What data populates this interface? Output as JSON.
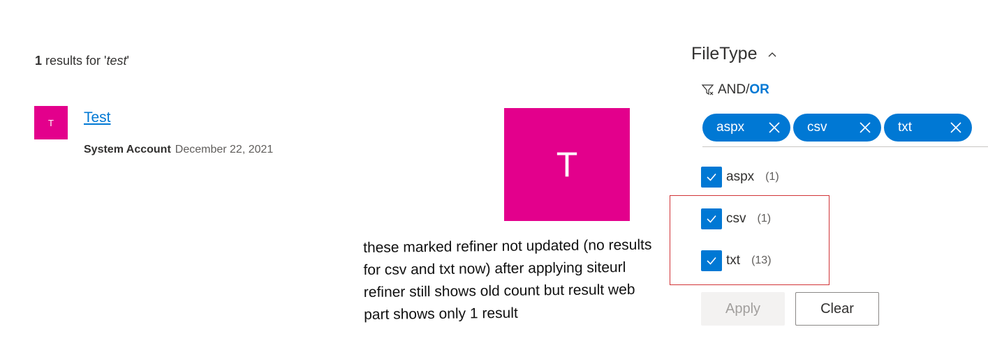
{
  "results": {
    "count": "1",
    "label_middle": " results for '",
    "query": "test",
    "label_end": "'"
  },
  "result_item": {
    "avatar_letter": "T",
    "title": "Test",
    "author": "System Account",
    "date": "December 22, 2021"
  },
  "preview": {
    "letter": "T"
  },
  "annotation": {
    "text": "these marked refiner not updated (no results for csv and txt now) after applying siteurl refiner still shows old count but result web part shows only 1 result"
  },
  "refiner": {
    "title": "FileType",
    "and_label": "AND",
    "separator": "/",
    "or_label": "OR",
    "pills": [
      {
        "label": "aspx"
      },
      {
        "label": "csv"
      },
      {
        "label": "txt"
      }
    ],
    "options": [
      {
        "label": "aspx",
        "count": "(1)",
        "checked": true
      },
      {
        "label": "csv",
        "count": "(1)",
        "checked": true
      },
      {
        "label": "txt",
        "count": "(13)",
        "checked": true
      }
    ],
    "apply_label": "Apply",
    "clear_label": "Clear"
  },
  "colors": {
    "accent": "#0078d4",
    "thumb": "#e3008c",
    "highlight": "#d13438"
  }
}
